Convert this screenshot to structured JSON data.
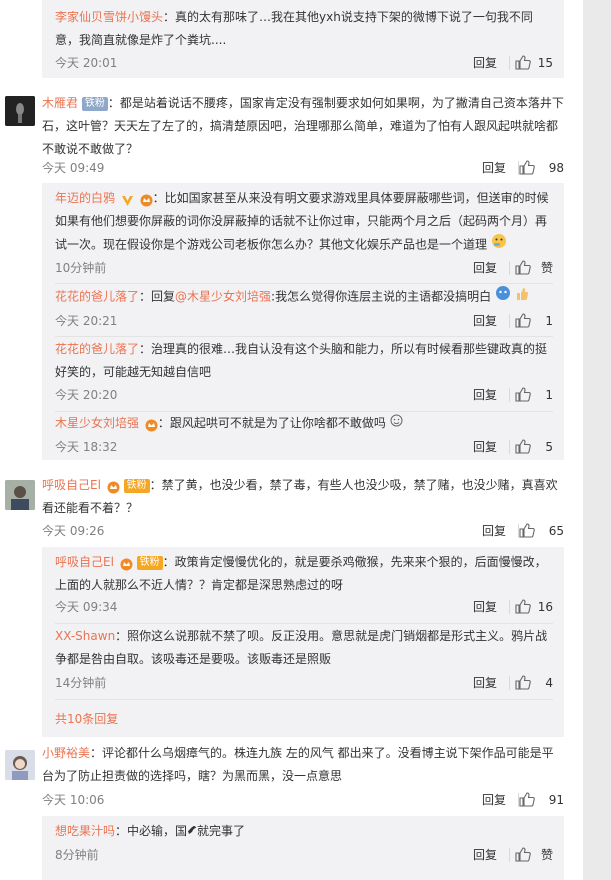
{
  "colors": {
    "username": "#eb7350",
    "text": "#333333",
    "meta": "#808080",
    "sub_bg": "#f2f2f5"
  },
  "top_sub": {
    "user": "李家仙贝雪饼小馒头",
    "text": "：真的太有那味了…我在其他yxh说支持下架的微博下说了一句我不同意，我简直就像是炸了个粪坑....",
    "time": "今天 20:01",
    "reply": "回复",
    "likes": "15"
  },
  "comment1": {
    "user": "木雁君",
    "badge": "铁粉",
    "text": "：都是站着说话不腰疼，国家肯定没有强制要求如何如果啊，为了撇清自己资本落井下石，这叶管？天天左了左了的，搞清楚原因吧，治理哪那么简单，难道为了怕有人跟风起哄就啥都不敢说不敢做了？",
    "time": "今天 09:49",
    "reply": "回复",
    "likes": "98",
    "subs": [
      {
        "user": "年迈的白鸦",
        "text": "：比如国家甚至从来没有明文要求游戏里具体要屏蔽哪些词，但送审的时候如果有他们想要你屏蔽的词你没屏蔽掉的话就不让你过审，只能两个月之后（起码两个月）再试一次。现在假设你是个游戏公司老板你怎么办？其他文化娱乐产品也是一个道理",
        "time": "10分钟前",
        "reply": "回复",
        "likes": "赞"
      },
      {
        "user": "花花的爸儿落了",
        "prefix": "：回复",
        "mention": "@木星少女刘培强",
        "text": ":我怎么觉得你连层主说的主语都没搞明白",
        "time": "今天 20:21",
        "reply": "回复",
        "likes": "1"
      },
      {
        "user": "花花的爸儿落了",
        "text": "：治理真的很难…我自认没有这个头脑和能力，所以有时候看那些键政真的挺好笑的，可能越无知越自信吧",
        "time": "今天 20:20",
        "reply": "回复",
        "likes": "1"
      },
      {
        "user": "木星少女刘培强",
        "text": "：跟风起哄可不就是为了让你啥都不敢做吗",
        "time": "今天 18:32",
        "reply": "回复",
        "likes": "5"
      }
    ]
  },
  "comment2": {
    "user": "呼吸自己El",
    "badge": "铁粉",
    "text": "：禁了黄，也没少看，禁了毒，有些人也没少吸，禁了赌，也没少赌，真喜欢看还能看不着？？",
    "time": "今天 09:26",
    "reply": "回复",
    "likes": "65",
    "subs": [
      {
        "user": "呼吸自己El",
        "badge": "铁粉",
        "text": "：政策肯定慢慢优化的，就是要杀鸡儆猴，先来来个狠的，后面慢慢改，上面的人就那么不近人情？？肯定都是深思熟虑过的呀",
        "time": "今天 09:34",
        "reply": "回复",
        "likes": "16"
      },
      {
        "user": "XX-Shawn",
        "text": "：照你这么说那就不禁了呗。反正没用。意思就是虎门销烟都是形式主义。鸦片战争都是咎由自取。该吸毒还是要吸。该贩毒还是照贩",
        "time": "14分钟前",
        "reply": "回复",
        "likes": "4"
      }
    ],
    "more": "共10条回复"
  },
  "comment3": {
    "user": "小野裕美",
    "text": "：评论都什么乌烟瘴气的。株连九族 左的风气 都出来了。没看博主说下架作品可能是平台为了防止担责做的选择吗，瞎？为黑而黑，没一点意思",
    "time": "今天 10:06",
    "reply": "回复",
    "likes": "91",
    "subs": [
      {
        "user": "想吃果汁吗",
        "text": "：中必输，国",
        "text_after": "就完事了",
        "time": "8分钟前",
        "reply": "回复",
        "likes": "赞"
      }
    ]
  }
}
